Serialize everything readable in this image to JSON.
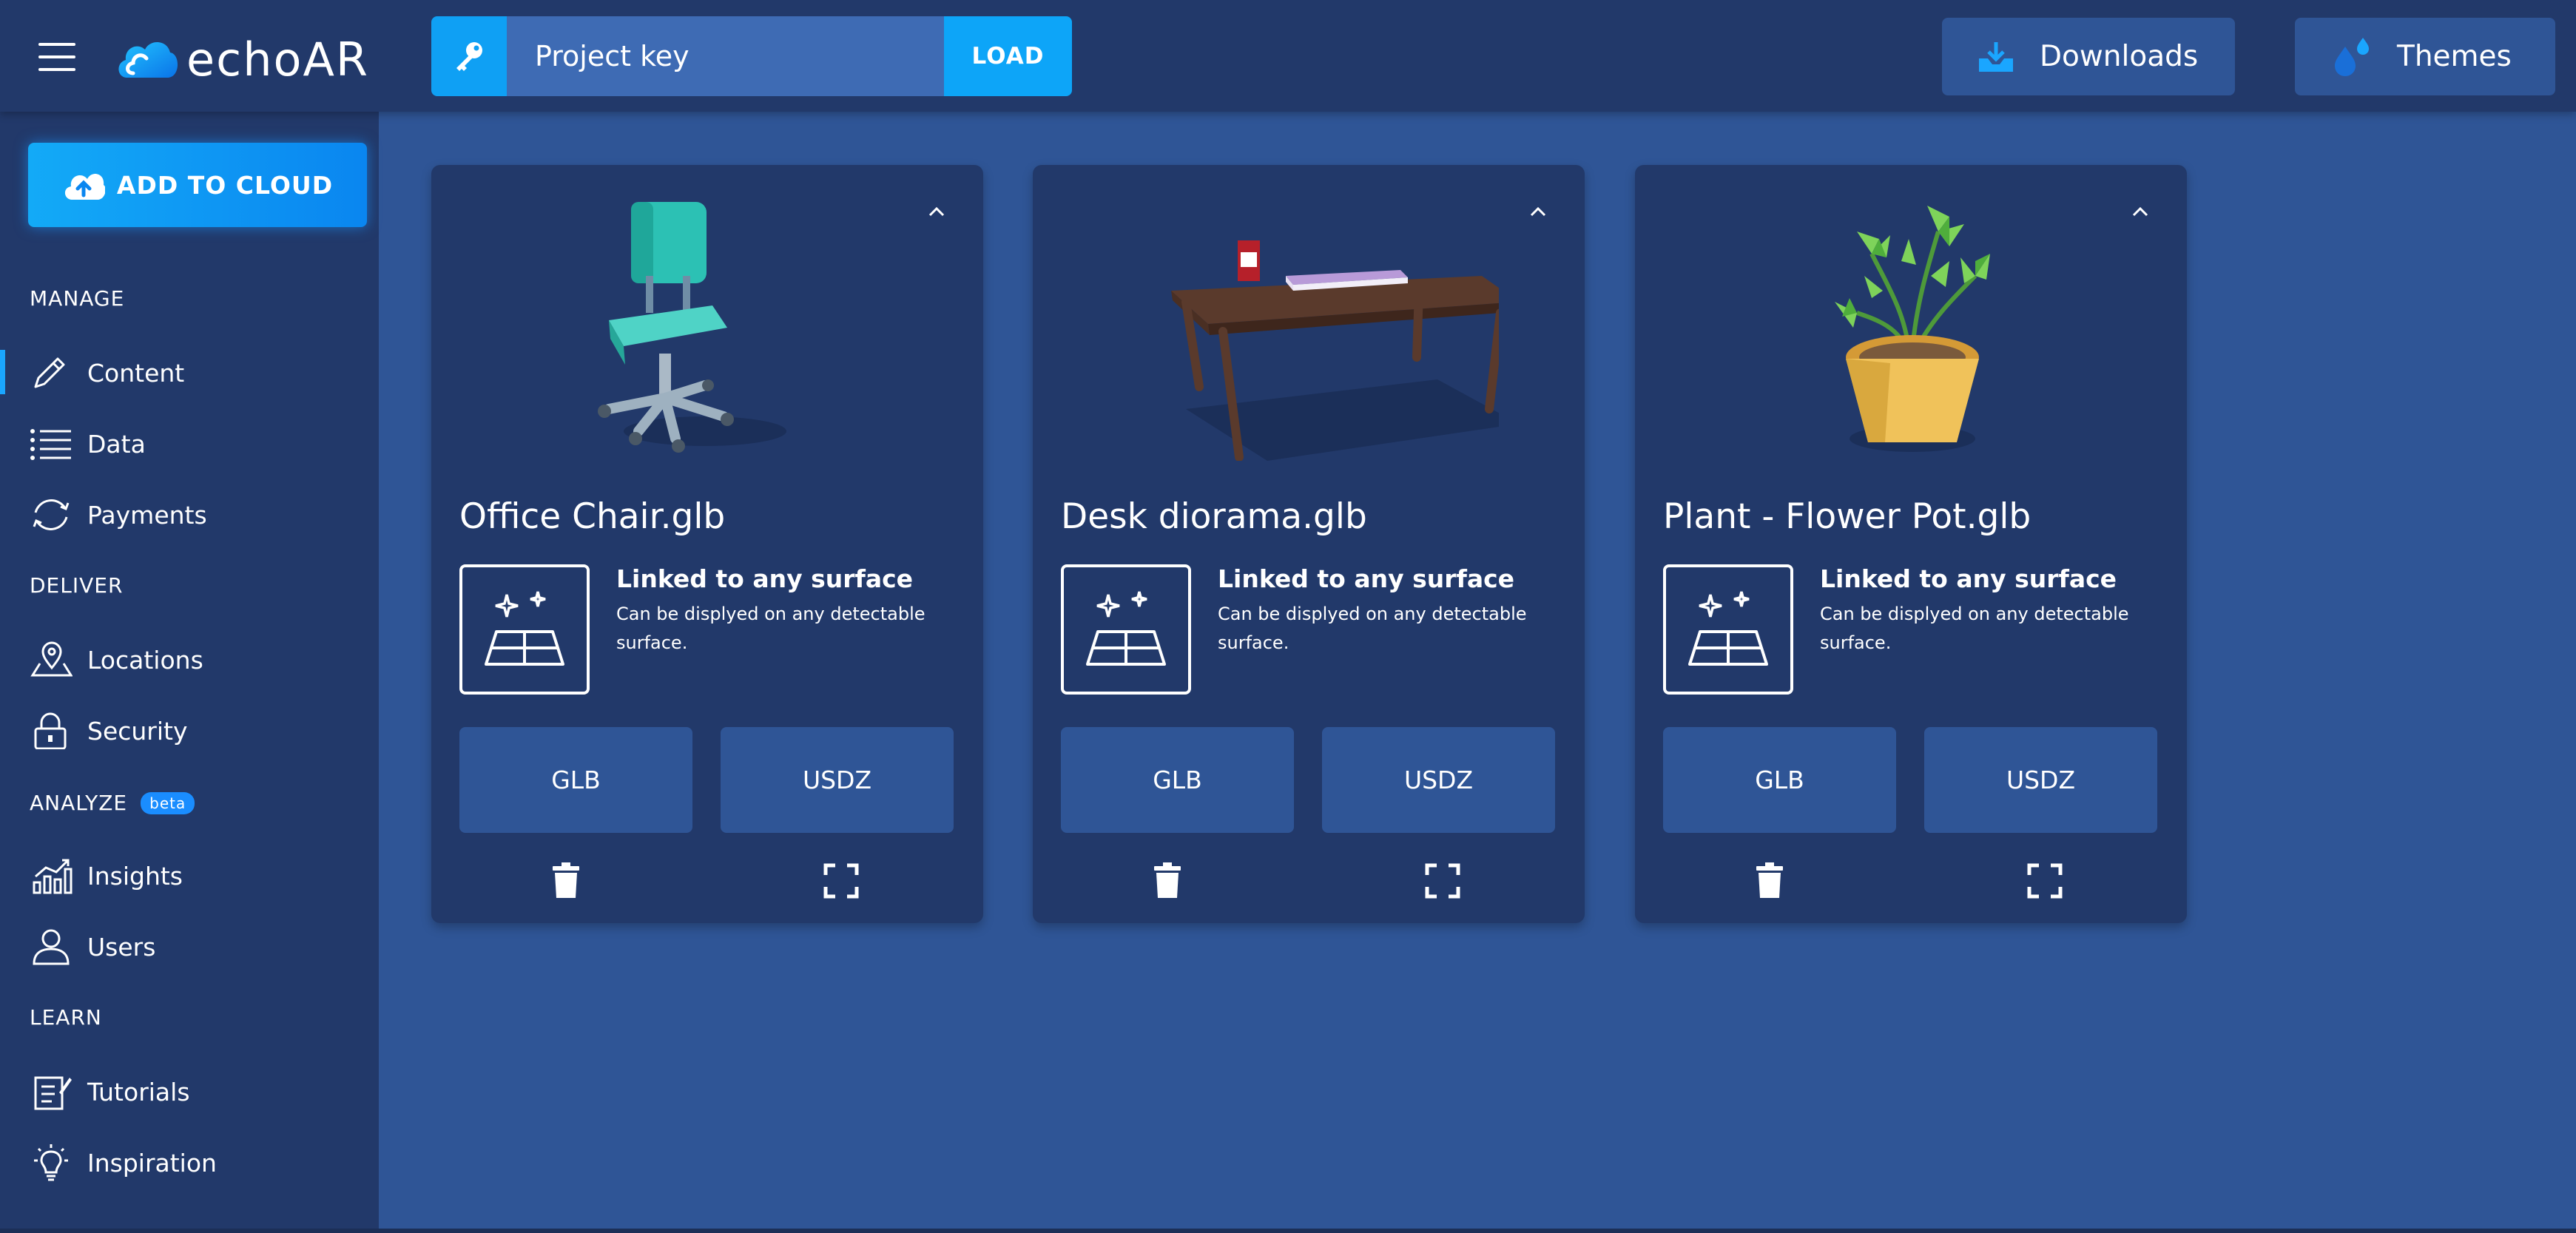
{
  "header": {
    "brand": "echoAR",
    "project_key_placeholder": "Project key",
    "load_label": "LOAD",
    "downloads_label": "Downloads",
    "themes_label": "Themes"
  },
  "sidebar": {
    "add_button": "ADD TO CLOUD",
    "sections": {
      "manage": "MANAGE",
      "deliver": "DELIVER",
      "analyze": "ANALYZE",
      "analyze_badge": "beta",
      "learn": "LEARN"
    },
    "items": {
      "content": {
        "label": "Content",
        "icon": "pencil-icon",
        "active": true
      },
      "data": {
        "label": "Data",
        "icon": "list-icon"
      },
      "payments": {
        "label": "Payments",
        "icon": "refresh-icon"
      },
      "locations": {
        "label": "Locations",
        "icon": "map-pin-icon"
      },
      "security": {
        "label": "Security",
        "icon": "lock-icon"
      },
      "insights": {
        "label": "Insights",
        "icon": "chart-icon"
      },
      "users": {
        "label": "Users",
        "icon": "user-icon"
      },
      "tutorials": {
        "label": "Tutorials",
        "icon": "notebook-icon"
      },
      "inspiration": {
        "label": "Inspiration",
        "icon": "lightbulb-icon"
      }
    }
  },
  "cards": [
    {
      "file_name": "Office Chair.glb",
      "anchor_title": "Linked to any surface",
      "anchor_desc": "Can be displyed on any detectable surface.",
      "glb_label": "GLB",
      "usdz_label": "USDZ"
    },
    {
      "file_name": "Desk diorama.glb",
      "anchor_title": "Linked to any surface",
      "anchor_desc": "Can be displyed on any detectable surface.",
      "glb_label": "GLB",
      "usdz_label": "USDZ"
    },
    {
      "file_name": "Plant - Flower Pot.glb",
      "anchor_title": "Linked to any surface",
      "anchor_desc": "Can be displyed on any detectable surface.",
      "glb_label": "GLB",
      "usdz_label": "USDZ"
    }
  ],
  "colors": {
    "background": "#2f5596",
    "panel": "#22396a",
    "accent": "#0fa0f4"
  }
}
